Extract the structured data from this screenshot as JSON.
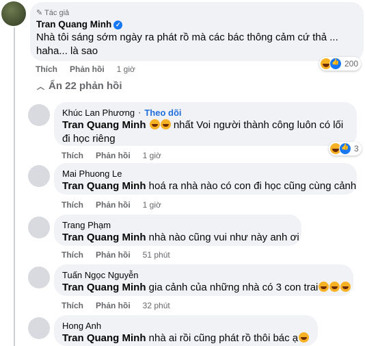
{
  "post_comment": {
    "badge": "Tác giả",
    "author": "Tran Quang Minh",
    "text": "Nhà tôi sáng sớm ngày ra phát rồ mà các bác thông cảm cứ thả ... haha... là sao",
    "actions": {
      "like": "Thích",
      "reply": "Phản hồi",
      "time": "1 giờ"
    },
    "reaction_count": "200"
  },
  "hide_replies": "Ẩn 22 phản hồi",
  "replies": [
    {
      "author": "Khúc Lan Phương",
      "follow": "Theo dõi",
      "mention": "Tran Quang Minh",
      "text_after": " nhất Voi người thành công luôn có lối đi học riêng",
      "time": "1 giờ",
      "reaction_count": "3"
    },
    {
      "author": "Mai Phuong Le",
      "mention": "Tran Quang Minh",
      "text_after": " hoá ra nhà nào có con đi học cũng cùng cảnh",
      "time": "1 giờ"
    },
    {
      "author": "Trang Phạm",
      "mention": "Tran Quang Minh",
      "text_after": " nhà nào cũng vui như này anh ơi",
      "time": "51 phút"
    },
    {
      "author": "Tuấn Ngọc Nguyễn",
      "mention": "Tran Quang Minh",
      "text_after": " gia cảnh của những nhà có 3 con trai",
      "time": "32 phút"
    },
    {
      "author": "Hong Anh",
      "mention": "Tran Quang Minh",
      "text_after": " nhà ai rồi cũng phát rồ thôi bác ạ"
    }
  ],
  "labels": {
    "like": "Thích",
    "reply": "Phản hồi"
  },
  "icons": {
    "verified": "verified-badge-icon",
    "haha": "haha-emoji-icon",
    "like": "like-icon",
    "grin": "grin-emoji-icon"
  },
  "colors": {
    "bubble": "#f0f2f5",
    "meta": "#65676b",
    "link": "#216fdb"
  }
}
